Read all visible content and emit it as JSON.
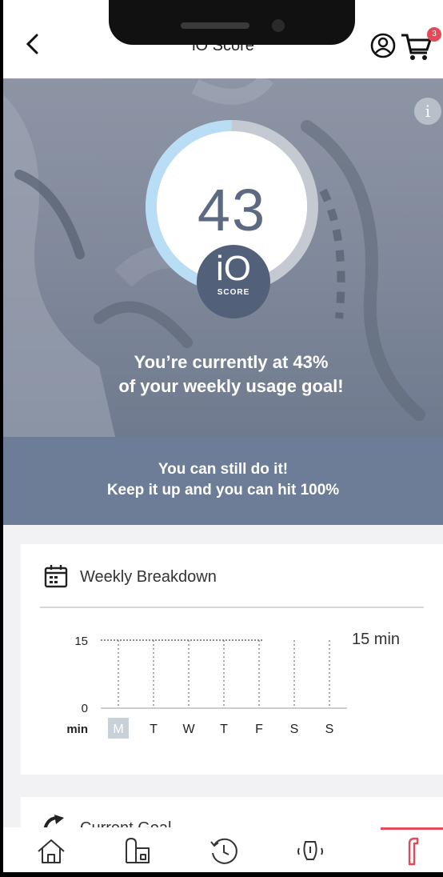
{
  "header": {
    "title": "iO Score",
    "cart_count": "3"
  },
  "hero": {
    "score": "43",
    "badge_logo": "iO",
    "badge_label": "SCORE",
    "progress_percent": 43,
    "message_line1": "You’re currently at 43%",
    "message_line2": "of your weekly usage goal!",
    "info_icon": "info-icon"
  },
  "banner": {
    "line1": "You can still do it!",
    "line2": "Keep it up and you can hit 100%"
  },
  "weekly": {
    "title": "Weekly Breakdown",
    "goal_label": "15 min"
  },
  "chart_data": {
    "type": "bar",
    "categories": [
      "M",
      "T",
      "W",
      "T",
      "F",
      "S",
      "S"
    ],
    "values": [
      0,
      0,
      0,
      0,
      0,
      0,
      0
    ],
    "highlighted": "M",
    "goal": 15,
    "ylim": [
      0,
      15
    ],
    "yticks": [
      "15",
      "0"
    ],
    "ylabel": "min",
    "grid": "dotted vertical"
  },
  "current_goal": {
    "title": "Current Goal"
  },
  "nav": {
    "items": [
      "home-icon",
      "devices-icon",
      "history-icon",
      "tips-icon",
      "brush-icon"
    ],
    "active": "brush-icon"
  },
  "colors": {
    "accent": "#e34a5a",
    "ring_progress": "#b9ddf5",
    "ring_track": "#c5c9d1",
    "badge": "#52607a",
    "banner": "#6d7c97"
  }
}
